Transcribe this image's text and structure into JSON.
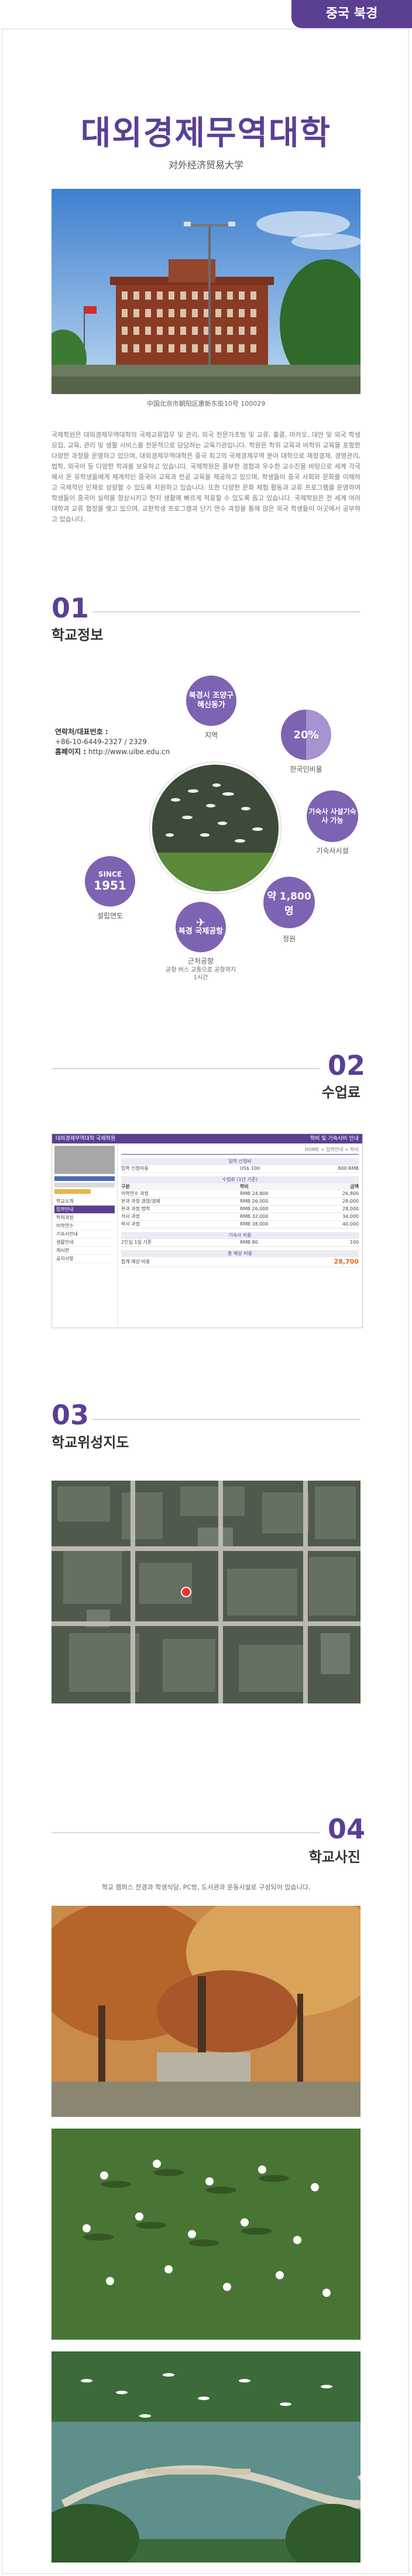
{
  "header": {
    "tag": "중국 북경"
  },
  "school": {
    "name": "대외경제무역대학",
    "chinese_name": "对外经济贸易大学",
    "photo_caption": "中国北京市朝阳区惠新东街10号 100029",
    "intro": "국제학원은 대외경제무역대학의 국제교류업무 및 관리, 외국 전문가초빙 및 교류, 홍콩, 마카오, 대만 및 외국 학생 모집, 교육, 관리 및 생활 서비스를 전문적으로 담당하는 교육기관입니다. 학원은 학위 교육과 비학위 교육을 포함한 다양한 과정을 운영하고 있으며, 대외경제무역대학은 중국 최고의 국제경제무역 분야 대학으로 재정경제, 경영관리, 법학, 외국어 등 다양한 학과를 보유하고 있습니다. 국제학원은 풍부한 경험과 우수한 교수진을 바탕으로 세계 각국에서 온 유학생들에게 체계적인 중국어 교육과 전공 교육을 제공하고 있으며, 학생들이 중국 사회와 문화를 이해하고 국제적인 인재로 성장할 수 있도록 지원하고 있습니다. 또한 다양한 문화 체험 활동과 교류 프로그램을 운영하여 학생들이 중국어 실력을 향상시키고 현지 생활에 빠르게 적응할 수 있도록 돕고 있습니다. 국제학원은 전 세계 여러 대학과 교류 협정을 맺고 있으며, 교환학생 프로그램과 단기 연수 과정을 통해 많은 외국 학생들이 이곳에서 공부하고 있습니다."
  },
  "section1": {
    "num": "01",
    "title": "학교정보",
    "contact_label_tel": "연락처/대표번호 :",
    "contact_tel": "+86-10-6449-2327 / 2329",
    "contact_label_web": "홈페이지 :",
    "contact_web": "http://www.uibe.edu.cn",
    "items": [
      {
        "circle": "북경시 조양구 혜신동가",
        "label": "지역"
      },
      {
        "circle": "20%",
        "label": "한국인비율"
      },
      {
        "circle": "기숙사 사설기숙사 가능",
        "label": "기숙사시설"
      },
      {
        "circle": "약 1,800명",
        "label": "정원"
      },
      {
        "circle": "북경 국제공항",
        "label": "근처공항",
        "sub": "공항 버스 교통으로 공항까지 1시간"
      },
      {
        "circle": "1951",
        "circle_top": "SINCE",
        "label": "설립연도"
      }
    ]
  },
  "section2": {
    "num": "02",
    "title": "수업료",
    "table": {
      "header_left": "대외경제무역대학 국제학원",
      "header_right": "학비 및 기숙사비 안내",
      "breadcrumb": "HOME > 입학안내 > 학비",
      "sidebar": [
        "학교소개",
        "입학안내",
        "학위과정",
        "어학연수",
        "기숙사안내",
        "생활안내",
        "게시판",
        "공지사항"
      ],
      "section_a": "입학 신청비",
      "row_a": [
        "입학 신청비용",
        "US$ 100",
        "800 RMB"
      ],
      "section_b": "수업료 (1년 기준)",
      "col_heads": [
        "구분",
        "학비",
        "금액"
      ],
      "rows_b": [
        [
          "어학연수 과정",
          "RMB 24,800",
          "26,800"
        ],
        [
          "본과 과정 경영/경제",
          "RMB 26,000",
          "28,000"
        ],
        [
          "본과 과정 법학",
          "RMB 26,000",
          "28,000"
        ],
        [
          "석사 과정",
          "RMB 32,000",
          "34,000"
        ],
        [
          "박사 과정",
          "RMB 38,000",
          "40,000"
        ]
      ],
      "section_c": "기숙사 비용",
      "row_c": [
        "2인실 1일 기준",
        "RMB 80",
        "100"
      ],
      "section_d": "총 예상 비용",
      "total_label": "합계 예상 비용",
      "total_value": "28,700"
    }
  },
  "section3": {
    "num": "03",
    "title": "학교위성지도"
  },
  "section4": {
    "num": "04",
    "title": "학교사진",
    "caption": "학교 캠퍼스 전경과 학생식당, PC방, 도서관과 운동시설로 구성되어 있습니다."
  }
}
